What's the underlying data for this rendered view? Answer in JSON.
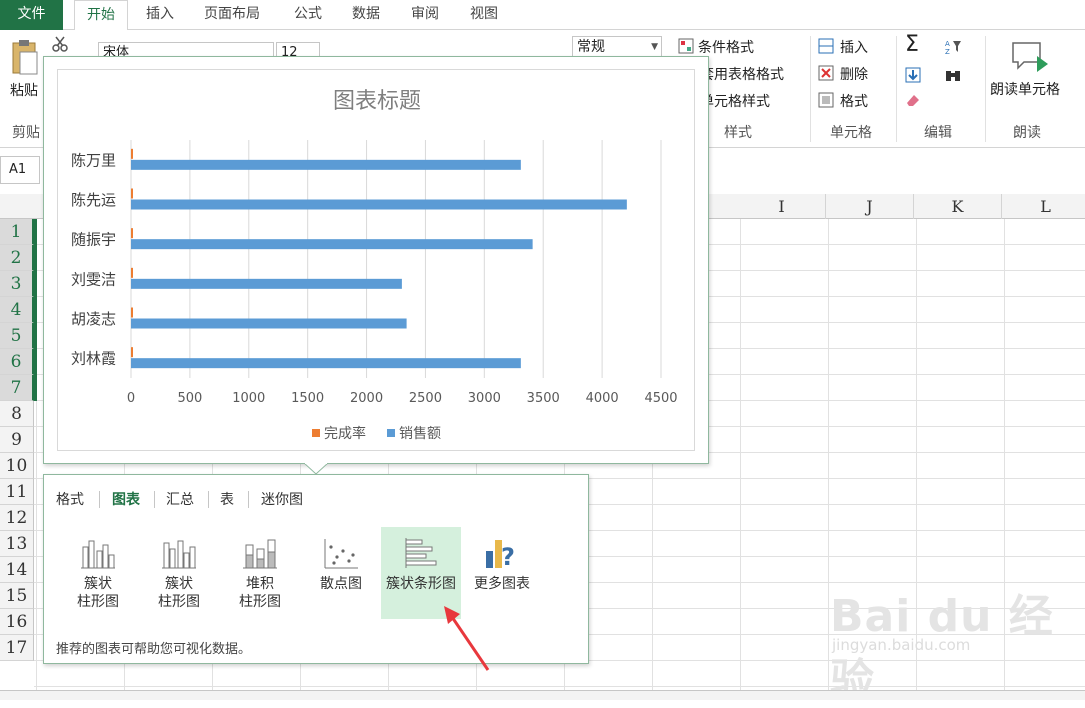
{
  "tabs": [
    {
      "label": "文件",
      "x": 0,
      "w": 63
    },
    {
      "label": "开始",
      "x": 74,
      "w": 54
    },
    {
      "label": "插入",
      "x": 134,
      "w": 52
    },
    {
      "label": "页面布局",
      "x": 192,
      "w": 80
    },
    {
      "label": "公式",
      "x": 282,
      "w": 52
    },
    {
      "label": "数据",
      "x": 340,
      "w": 52
    },
    {
      "label": "审阅",
      "x": 399,
      "w": 52
    },
    {
      "label": "视图",
      "x": 458,
      "w": 52
    }
  ],
  "ribbon": {
    "paste_label": "粘贴",
    "clipboard_group": "剪贴",
    "font_name": "宋体",
    "font_size": "12",
    "number_format": "常规",
    "conditional_format": "条件格式",
    "table_format": "套用表格格式",
    "cell_style": "单元格样式",
    "styles_group": "样式",
    "insert": "插入",
    "delete": "删除",
    "format": "格式",
    "cells_group": "单元格",
    "editing_group": "编辑",
    "read_cell": "朗读单元格",
    "read_group": "朗读",
    "sort_icon_text": "A Z"
  },
  "formula_bar": {
    "name_box": "A1"
  },
  "columns": [
    "I",
    "J",
    "K",
    "L"
  ],
  "rows": [
    "1",
    "2",
    "3",
    "4",
    "5",
    "6",
    "7",
    "8",
    "9",
    "10",
    "11",
    "12",
    "13",
    "14",
    "15",
    "16",
    "17"
  ],
  "selected_rows": [
    1,
    2,
    3,
    4,
    5,
    6,
    7
  ],
  "chart_data": {
    "type": "bar",
    "orientation": "horizontal",
    "title": "图表标题",
    "categories": [
      "陈万里",
      "陈先运",
      "随振宇",
      "刘雯洁",
      "胡凌志",
      "刘林霞"
    ],
    "series": [
      {
        "name": "完成率",
        "color": "#ED7D31",
        "values": [
          1,
          1,
          1,
          1,
          1,
          1
        ]
      },
      {
        "name": "销售额",
        "color": "#5B9BD5",
        "values": [
          3310,
          4210,
          3410,
          2300,
          2340,
          3310
        ]
      }
    ],
    "xlim": [
      0,
      4500
    ],
    "xticks": [
      "0",
      "500",
      "1000",
      "1500",
      "2000",
      "2500",
      "3000",
      "3500",
      "4000",
      "4500"
    ],
    "grid": true,
    "legend": "bottom"
  },
  "quick_analysis": {
    "tabs": [
      {
        "label": "格式",
        "active": false
      },
      {
        "label": "图表",
        "active": true
      },
      {
        "label": "汇总",
        "active": false
      },
      {
        "label": "表",
        "active": false
      },
      {
        "label": "迷你图",
        "active": false
      }
    ],
    "items": [
      {
        "line1": "簇状",
        "line2": "柱形图",
        "icon": "clustered-column-icon",
        "highlight": false
      },
      {
        "line1": "簇状",
        "line2": "柱形图",
        "icon": "clustered-column-icon",
        "highlight": false
      },
      {
        "line1": "堆积",
        "line2": "柱形图",
        "icon": "stacked-column-icon",
        "highlight": false
      },
      {
        "line1": "散点图",
        "line2": "",
        "icon": "scatter-icon",
        "highlight": false
      },
      {
        "line1": "簇状条形图",
        "line2": "",
        "icon": "clustered-bar-icon",
        "highlight": true
      },
      {
        "line1": "更多图表",
        "line2": "",
        "icon": "more-charts-icon",
        "highlight": false
      }
    ],
    "footer": "推荐的图表可帮助您可视化数据。"
  },
  "watermark": {
    "main": "Bai du 经验",
    "sub": "jingyan.baidu.com"
  },
  "colors": {
    "accent": "#217346",
    "arrow": "#e8383d"
  }
}
